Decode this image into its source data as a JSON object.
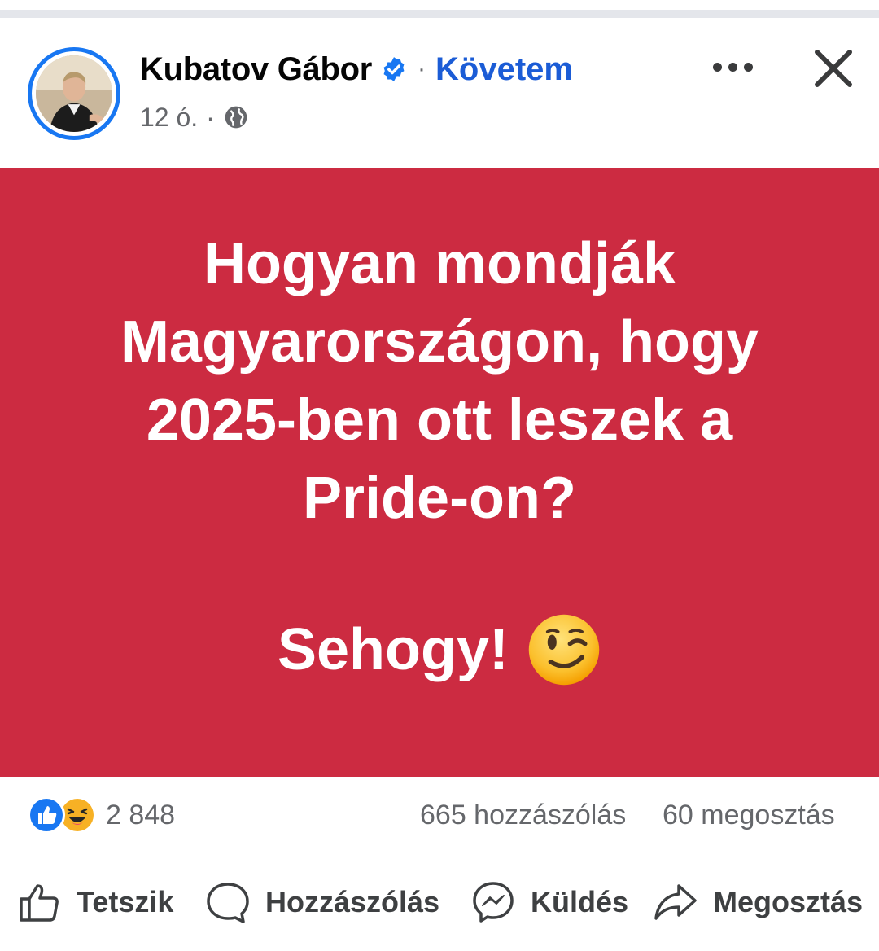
{
  "post": {
    "author": "Kubatov Gábor",
    "separator": "·",
    "follow_label": "Követem",
    "time": "12 ó.",
    "time_separator": "·",
    "question": "Hogyan mondják Magyarországon, hogy 2025-ben ott leszek a Pride-on?",
    "answer": "Sehogy!",
    "background_color": "#cc2b41"
  },
  "stats": {
    "reaction_count": "2 848",
    "comments": "665 hozzászólás",
    "shares": "60 megosztás"
  },
  "actions": {
    "like": "Tetszik",
    "comment": "Hozzászólás",
    "send": "Küldés",
    "share": "Megosztás"
  },
  "icons": {
    "verified": "verified-badge-icon",
    "globe": "globe-icon",
    "more": "more-options-icon",
    "close": "close-icon",
    "wink": "wink-emoji-icon",
    "like_reaction": "like-reaction-icon",
    "haha_reaction": "haha-reaction-icon"
  },
  "colors": {
    "accent": "#1877f2",
    "follow_text": "#1b5cd6",
    "secondary_text": "#65676b"
  }
}
